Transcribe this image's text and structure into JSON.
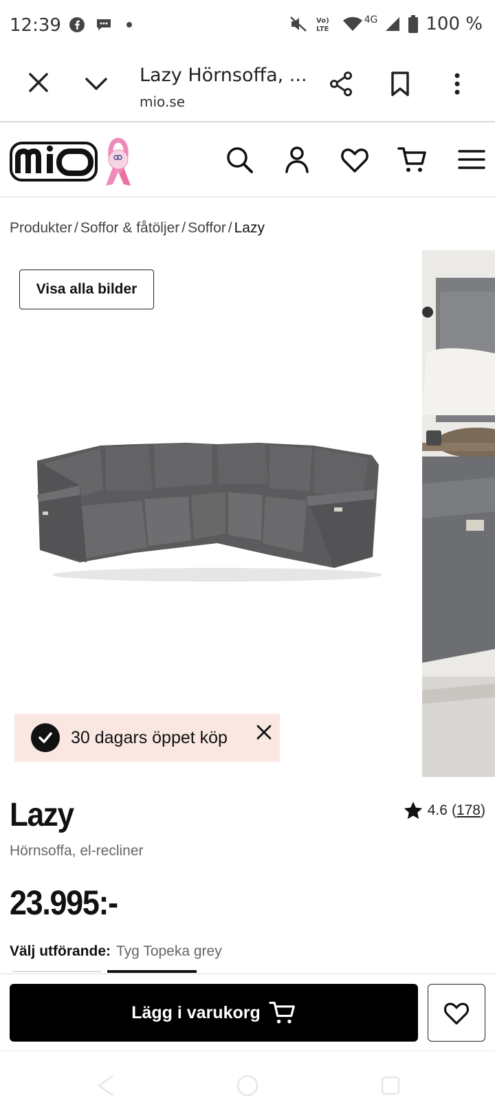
{
  "status_bar": {
    "time": "12:39",
    "battery": "100 %",
    "network": "4G",
    "left_icons": [
      "facebook-icon",
      "messenger-icon",
      "dot-icon"
    ],
    "right_icons": [
      "mute-icon",
      "volte-icon",
      "wifi-icon",
      "signal-icon",
      "battery-icon"
    ]
  },
  "browser": {
    "title": "Lazy Hörnsoffa, ...",
    "url": "mio.se"
  },
  "breadcrumb": {
    "items": [
      "Produkter",
      "Soffor & fåtöljer",
      "Soffor",
      "Lazy"
    ],
    "separator": "/"
  },
  "gallery": {
    "view_all_label": "Visa alla bilder"
  },
  "promo": {
    "text": "30 dagars öppet köp"
  },
  "product": {
    "name": "Lazy",
    "subtitle": "Hörnsoffa, el-recliner",
    "rating": "4.6",
    "review_count": "178",
    "price": "23.995:-",
    "variant_label": "Välj utförande:",
    "variant_value": "Tyg Topeka grey"
  },
  "actions": {
    "add_to_cart_label": "Lägg i varukorg"
  },
  "colors": {
    "promo_bg": "#fbe7e2",
    "ribbon_pink": "#f08ab8",
    "sofa_grey": "#5b5b5d",
    "button_black": "#000000"
  }
}
